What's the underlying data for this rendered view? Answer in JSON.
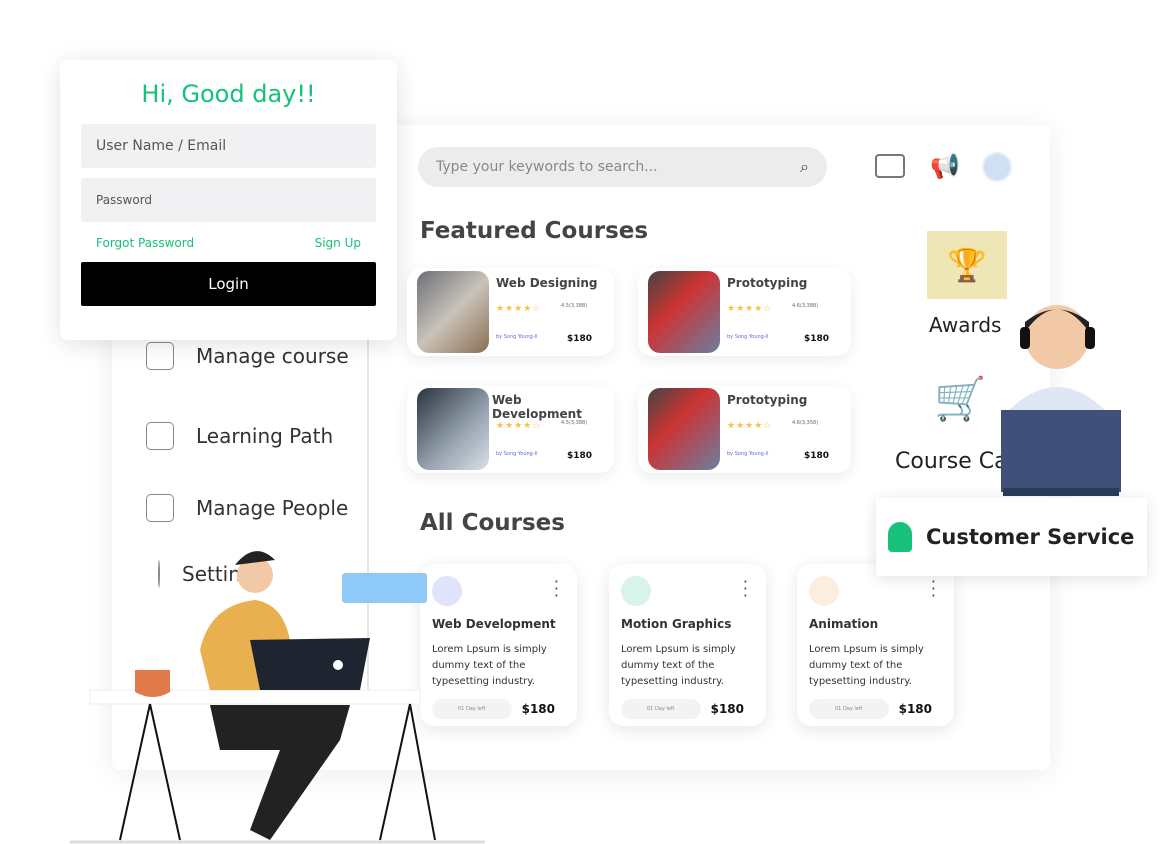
{
  "login": {
    "greeting": "Hi, Good day!!",
    "username_placeholder": "User Name / Email",
    "password_placeholder": "Password",
    "forgot": "Forgot Password",
    "signup": "Sign Up",
    "login_button": "Login"
  },
  "search": {
    "placeholder": "Type your keywords to search..."
  },
  "sidebar": {
    "items": [
      {
        "label": "Manage course",
        "icon": "book-user-icon"
      },
      {
        "label": "Learning Path",
        "icon": "graduate-icon"
      },
      {
        "label": "Manage People",
        "icon": "people-gear-icon"
      },
      {
        "label": "Settings",
        "icon": "gear-icon"
      }
    ]
  },
  "featured": {
    "title": "Featured Courses",
    "courses": [
      {
        "title": "Web Designing",
        "rating": "4.5(3,388)",
        "stars": 4,
        "author": "by Song Young-Il",
        "price": "$180"
      },
      {
        "title": "Prototyping",
        "rating": "4.6(3,388)",
        "stars": 4,
        "author": "by Song Young-Il",
        "price": "$180"
      },
      {
        "title": "Web Development",
        "rating": "4.5(3,388)",
        "stars": 4,
        "author": "by Song Young-Il",
        "price": "$180"
      },
      {
        "title": "Prototyping",
        "rating": "4.6(3,358)",
        "stars": 4,
        "author": "by Song Young-Il",
        "price": "$180"
      }
    ]
  },
  "all": {
    "title": "All Courses",
    "courses": [
      {
        "title": "Web Development",
        "desc": "Lorem Lpsum is simply dummy text of the typesetting industry.",
        "days": "01 Day left",
        "price": "$180",
        "color": "#dfe3fb"
      },
      {
        "title": "Motion Graphics",
        "desc": "Lorem Lpsum is simply dummy text of the typesetting industry.",
        "days": "01 Day left",
        "price": "$180",
        "color": "#d8f3ec"
      },
      {
        "title": "Animation",
        "desc": "Lorem Lpsum is simply dummy text of the typesetting industry.",
        "days": "01 Day left",
        "price": "$180",
        "color": "#fbeede"
      }
    ]
  },
  "right": {
    "awards": "Awards",
    "cart": "Course Cart",
    "customer_service": "Customer Service"
  },
  "colors": {
    "accent": "#16c17a",
    "cart": "#13b5f0",
    "star": "#f6c343"
  }
}
